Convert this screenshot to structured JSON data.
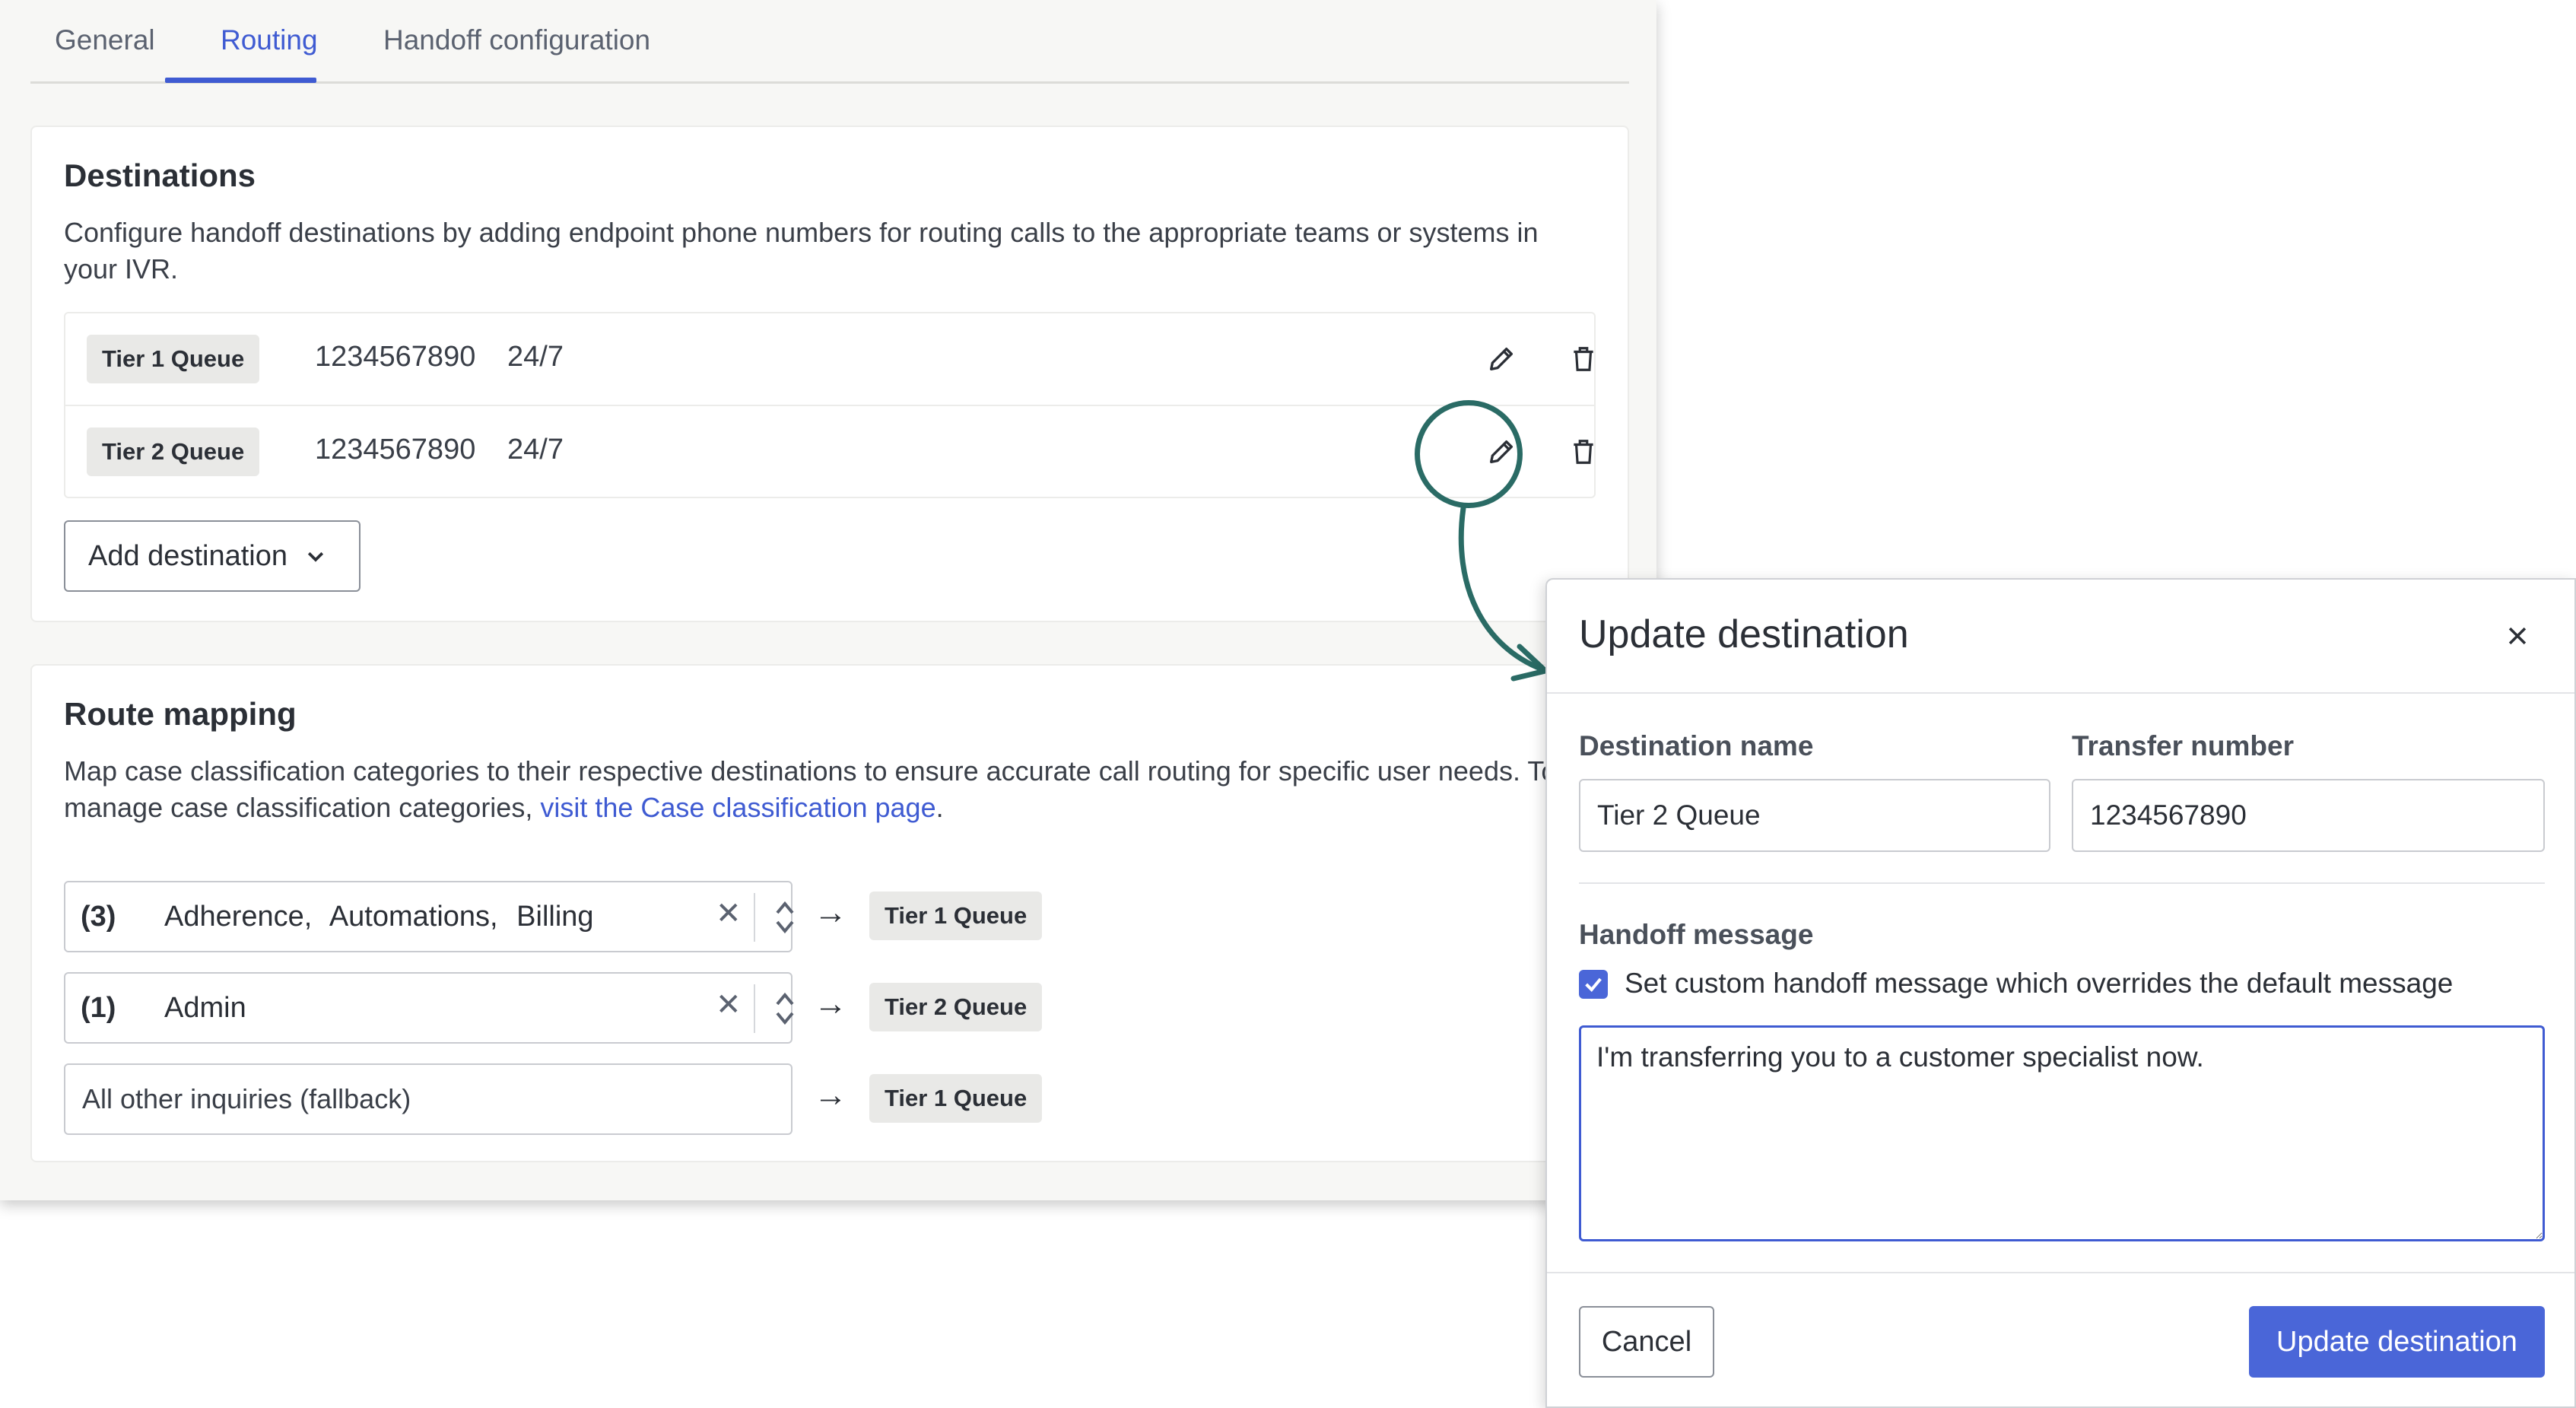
{
  "tabs": [
    {
      "label": "General"
    },
    {
      "label": "Routing",
      "active": true
    },
    {
      "label": "Handoff configuration"
    }
  ],
  "destinations": {
    "title": "Destinations",
    "description": "Configure handoff destinations by adding endpoint phone numbers for routing calls to the appropriate teams or systems in your IVR.",
    "rows": [
      {
        "name": "Tier 1 Queue",
        "number": "1234567890",
        "hours": "24/7"
      },
      {
        "name": "Tier 2 Queue",
        "number": "1234567890",
        "hours": "24/7"
      }
    ],
    "add_label": "Add destination"
  },
  "route_mapping": {
    "title": "Route mapping",
    "description": "Map case classification categories to their respective destinations to ensure accurate call routing for specific user needs. To manage case classification categories, ",
    "link_text": "visit the Case classification page",
    "link_suffix": ".",
    "rows": [
      {
        "count": "(3)",
        "items": "Adherence,   Automations,   Billing",
        "destination": "Tier 1 Queue"
      },
      {
        "count": "(1)",
        "items": "Admin",
        "destination": "Tier 2 Queue"
      }
    ],
    "fallback": {
      "label": "All other inquiries (fallback)",
      "destination": "Tier 1 Queue"
    }
  },
  "dialog": {
    "title": "Update destination",
    "name_label": "Destination name",
    "name_value": "Tier 2 Queue",
    "number_label": "Transfer number",
    "number_value": "1234567890",
    "message_label": "Handoff message",
    "checkbox_label": "Set custom handoff message which overrides the default message",
    "checkbox_checked": true,
    "message_value": "I'm transferring you to a customer specialist now.",
    "cancel_label": "Cancel",
    "update_label": "Update destination"
  },
  "colors": {
    "accent": "#3f5bd2",
    "primary_button": "#4a66d8",
    "highlight": "#2a6b65"
  }
}
